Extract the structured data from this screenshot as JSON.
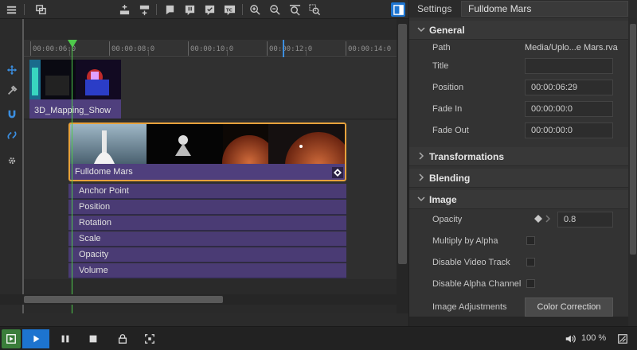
{
  "timeline": {
    "ruler_labels": [
      "00:00:06:0",
      "00:00:08:0",
      "00:00:10:0",
      "00:00:12:0",
      "00:00:14:0"
    ],
    "clips": [
      {
        "label": "3D_Mapping_Show"
      },
      {
        "label": "Fulldome Mars"
      }
    ],
    "keyframe_rows": [
      "Anchor Point",
      "Position",
      "Rotation",
      "Scale",
      "Opacity",
      "Volume"
    ]
  },
  "settings": {
    "panel_title": "Settings",
    "name_value": "Fulldome Mars",
    "sections": {
      "general": "General",
      "transformations": "Transformations",
      "blending": "Blending",
      "image": "Image"
    },
    "general": {
      "path_label": "Path",
      "path_value": "Media/Uplo...e Mars.rva",
      "title_label": "Title",
      "title_value": "",
      "position_label": "Position",
      "position_value": "00:00:06:29",
      "fade_in_label": "Fade In",
      "fade_in_value": "00:00:00:0",
      "fade_out_label": "Fade Out",
      "fade_out_value": "00:00:00:0"
    },
    "image": {
      "opacity_label": "Opacity",
      "opacity_value": "0.8",
      "multiply_label": "Multiply by Alpha",
      "disable_video_label": "Disable Video Track",
      "disable_alpha_label": "Disable Alpha Channel",
      "adjustments_label": "Image Adjustments",
      "color_correction_label": "Color Correction"
    }
  },
  "transport": {
    "zoom_label": "100 %"
  },
  "colors": {
    "accent": "#1d74cf",
    "clip": "#4f3f7d",
    "selection": "#e8a23c",
    "playhead": "#4ec94b"
  }
}
